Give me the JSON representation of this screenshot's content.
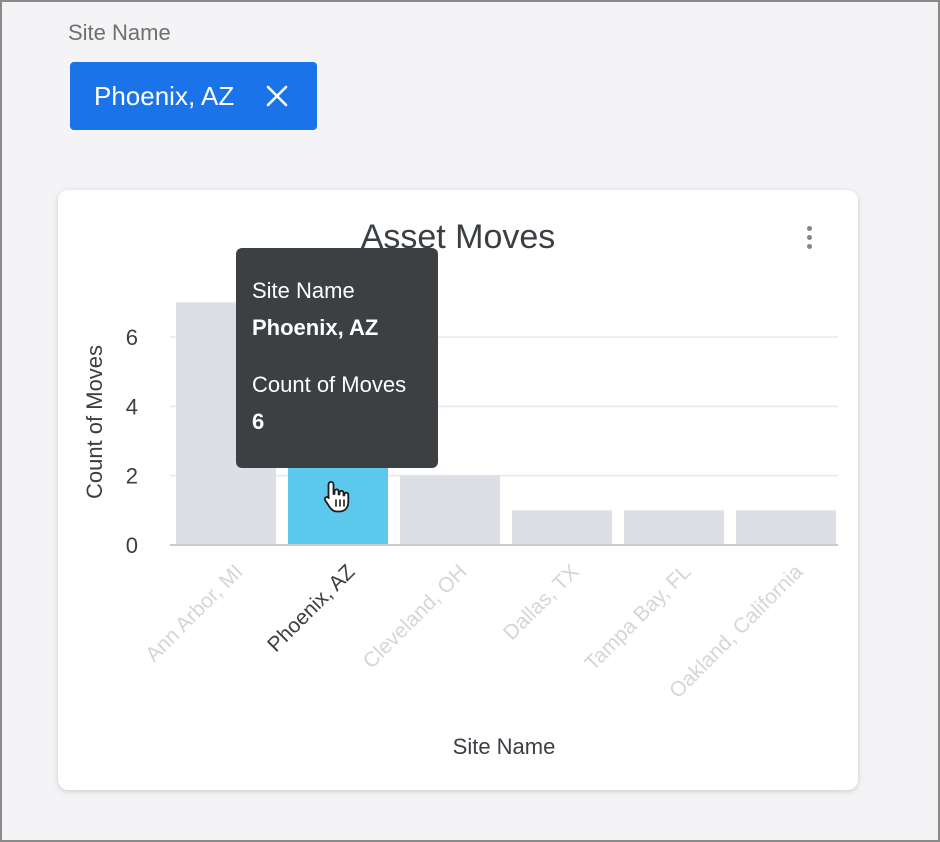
{
  "filter": {
    "label": "Site Name",
    "chip_value": "Phoenix, AZ"
  },
  "card": {
    "menu_icon": "more-vert-icon"
  },
  "chart_data": {
    "type": "bar",
    "title": "Asset Moves",
    "xlabel": "Site Name",
    "ylabel": "Count of Moves",
    "categories": [
      "Ann Arbor, MI",
      "Phoenix, AZ",
      "Cleveland, OH",
      "Dallas, TX",
      "Tampa Bay, FL",
      "Oakland, California"
    ],
    "values": [
      7,
      6,
      2,
      1,
      1,
      1
    ],
    "ylim": [
      0,
      7
    ],
    "yticks": [
      0,
      2,
      4,
      6
    ],
    "grid": true,
    "highlighted_category": "Phoenix, AZ",
    "colors": {
      "highlight": "#5bc8ec",
      "default": "#dcdfe3",
      "dim_label": "#d4d6d9",
      "active_label": "#3a3f44",
      "gridline": "#e6e8eb",
      "axis": "#c9ccd1"
    }
  },
  "tooltip": {
    "field_label": "Site Name",
    "field_value": "Phoenix, AZ",
    "measure_label": "Count of Moves",
    "measure_value": "6"
  }
}
